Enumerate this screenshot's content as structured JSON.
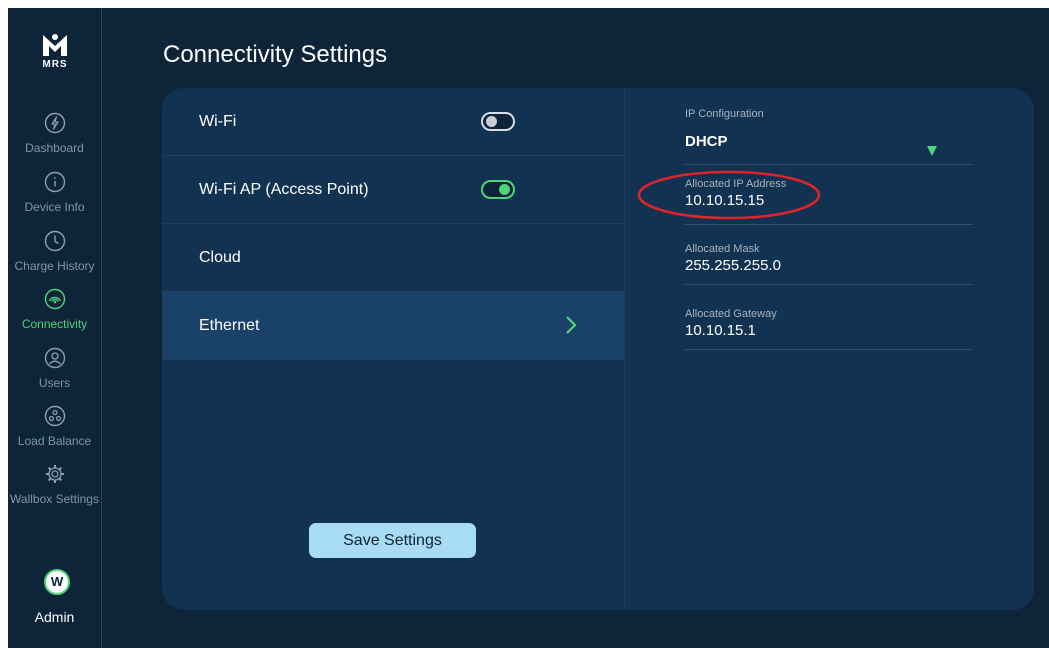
{
  "brand": {
    "logo_text": "MRS"
  },
  "sidebar": {
    "items": [
      {
        "label": "Dashboard",
        "icon": "bolt-icon",
        "active": false
      },
      {
        "label": "Device Info",
        "icon": "info-icon",
        "active": false
      },
      {
        "label": "Charge History",
        "icon": "clock-icon",
        "active": false
      },
      {
        "label": "Connectivity",
        "icon": "signal-icon",
        "active": true
      },
      {
        "label": "Users",
        "icon": "user-icon",
        "active": false
      },
      {
        "label": "Load Balance",
        "icon": "network-icon",
        "active": false
      },
      {
        "label": "Wallbox Settings",
        "icon": "gear-icon",
        "active": false
      }
    ],
    "user": {
      "avatar_initial": "W",
      "name": "Admin"
    }
  },
  "page": {
    "title": "Connectivity Settings"
  },
  "connections": [
    {
      "label": "Wi-Fi",
      "control": "toggle",
      "enabled": false
    },
    {
      "label": "Wi-Fi AP (Access Point)",
      "control": "toggle",
      "enabled": true
    },
    {
      "label": "Cloud",
      "control": "none"
    },
    {
      "label": "Ethernet",
      "control": "chevron",
      "selected": true
    }
  ],
  "actions": {
    "save_label": "Save Settings"
  },
  "ethernet": {
    "ip_config": {
      "label": "IP Configuration",
      "value": "DHCP"
    },
    "ip_address": {
      "label": "Allocated IP Address",
      "value": "10.10.15.15"
    },
    "mask": {
      "label": "Allocated Mask",
      "value": "255.255.255.0"
    },
    "gateway": {
      "label": "Allocated Gateway",
      "value": "10.10.15.1"
    }
  },
  "colors": {
    "background": "#0e2439",
    "card": "#123252",
    "selected_row": "#1a4168",
    "accent_green": "#4fd47a",
    "button": "#a8dbf4",
    "annotation_red": "#e0232b"
  }
}
